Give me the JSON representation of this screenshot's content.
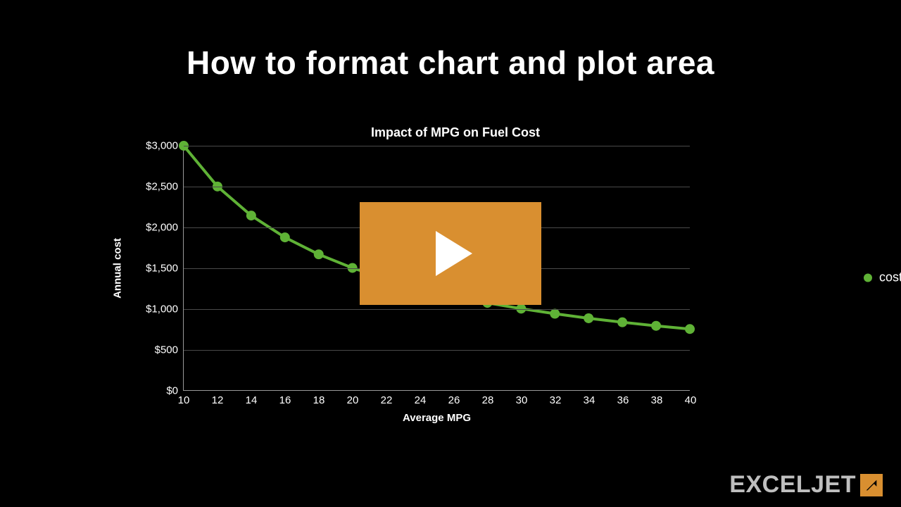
{
  "title": "How to format chart and plot area",
  "chart_data": {
    "type": "line",
    "title": "Impact of MPG on Fuel Cost",
    "xlabel": "Average MPG",
    "ylabel": "Annual cost",
    "xlim": [
      10,
      40
    ],
    "ylim": [
      0,
      3000
    ],
    "x_ticks": [
      10,
      12,
      14,
      16,
      18,
      20,
      22,
      24,
      26,
      28,
      30,
      32,
      34,
      36,
      38,
      40
    ],
    "y_ticks_raw": [
      0,
      500,
      1000,
      1500,
      2000,
      2500,
      3000
    ],
    "y_ticks": [
      "$0",
      "$500",
      "$1,000",
      "$1,500",
      "$2,000",
      "$2,500",
      "$3,000"
    ],
    "series": [
      {
        "name": "cost",
        "color": "#5fb236",
        "x": [
          10,
          12,
          14,
          16,
          18,
          20,
          22,
          24,
          26,
          28,
          30,
          32,
          34,
          36,
          38,
          40
        ],
        "y": [
          3000,
          2500,
          2143,
          1875,
          1667,
          1500,
          1364,
          1250,
          1154,
          1071,
          1000,
          938,
          882,
          833,
          789,
          750
        ]
      }
    ],
    "legend": {
      "entries": [
        "cost"
      ],
      "position": "right"
    },
    "grid": {
      "horizontal": true,
      "vertical": false
    }
  },
  "play_button": {
    "label": "Play video"
  },
  "brand": {
    "text": "EXCELJET"
  }
}
